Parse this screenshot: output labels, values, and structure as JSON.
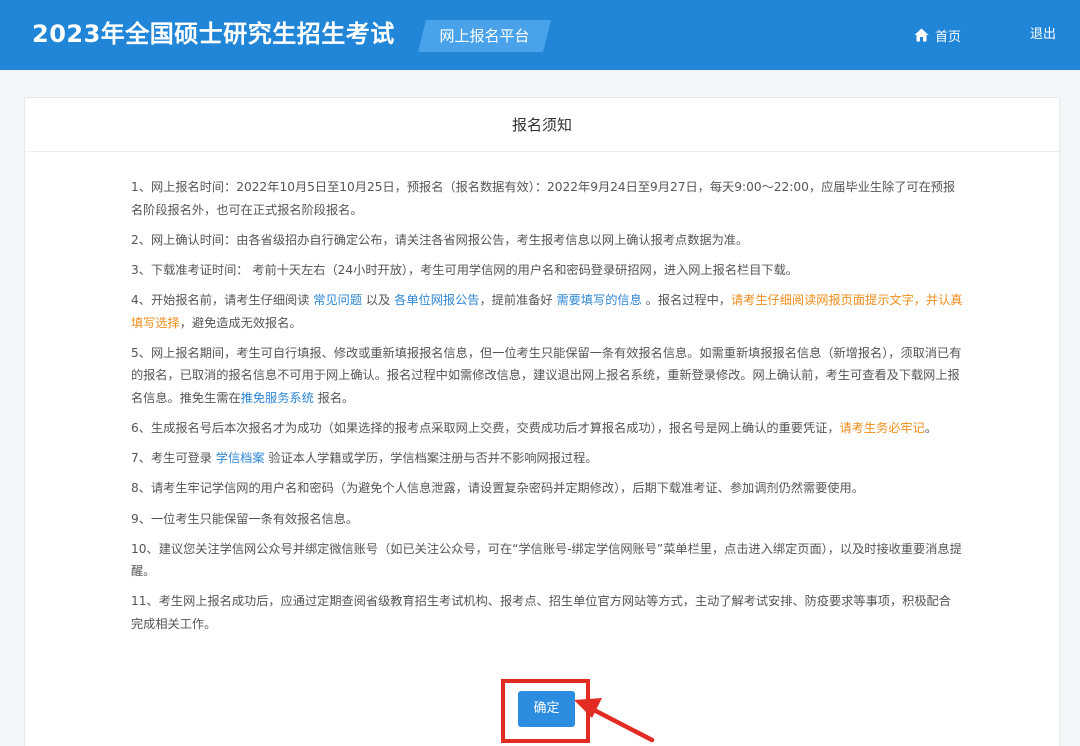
{
  "header": {
    "title": "2023年全国硕士研究生招生考试",
    "platform": "网上报名平台",
    "nav": {
      "home": "首页",
      "logout": "退出"
    }
  },
  "card": {
    "title": "报名须知"
  },
  "notices": {
    "n1": "1、网上报名时间：2022年10月5日至10月25日，预报名（报名数据有效）：2022年9月24日至9月27日，每天9:00～22:00，应届毕业生除了可在预报名阶段报名外，也可在正式报名阶段报名。",
    "n2": "2、网上确认时间：由各省级招办自行确定公布，请关注各省网报公告，考生报考信息以网上确认报考点数据为准。",
    "n3": "3、下载准考证时间： 考前十天左右（24小时开放），考生可用学信网的用户名和密码登录研招网，进入网上报名栏目下载。",
    "n4": {
      "a": "4、开始报名前，请考生仔细阅读 ",
      "link1": "常见问题",
      "b": " 以及 ",
      "link2": "各单位网报公告",
      "c": "，提前准备好 ",
      "link3": "需要填写的信息",
      "d": " 。报名过程中，",
      "hl": "请考生仔细阅读网报页面提示文字，并认真填写选择",
      "e": "，避免造成无效报名。"
    },
    "n5": {
      "a": "5、网上报名期间，考生可自行填报、修改或重新填报报名信息，但一位考生只能保留一条有效报名信息。如需重新填报报名信息（新增报名），须取消已有的报名，已取消的报名信息不可用于网上确认。报名过程中如需修改信息，建议退出网上报名系统，重新登录修改。网上确认前，考生可查看及下载网上报名信息。推免生需在",
      "link": "推免服务系统",
      "b": " 报名。"
    },
    "n6": {
      "a": "6、生成报名号后本次报名才为成功（如果选择的报考点采取网上交费，交费成功后才算报名成功），报名号是网上确认的重要凭证，",
      "hl": "请考生务必牢记",
      "b": "。"
    },
    "n7": {
      "a": "7、考生可登录 ",
      "link": "学信档案",
      "b": " 验证本人学籍或学历，学信档案注册与否并不影响网报过程。"
    },
    "n8": "8、请考生牢记学信网的用户名和密码（为避免个人信息泄露，请设置复杂密码并定期修改），后期下载准考证、参加调剂仍然需要使用。",
    "n9": "9、一位考生只能保留一条有效报名信息。",
    "n10": "10、建议您关注学信网公众号并绑定微信账号（如已关注公众号，可在“学信账号-绑定学信网账号”菜单栏里，点击进入绑定页面），以及时接收重要消息提醒。",
    "n11": "11、考生网上报名成功后，应通过定期查阅省级教育招生考试机构、报考点、招生单位官方网站等方式，主动了解考试安排、防疫要求等事项，积极配合完成相关工作。"
  },
  "confirm_label": "确定",
  "colors": {
    "header_bg": "#2186d8",
    "badge_bg": "#4aa3ea",
    "link": "#2f86d6",
    "highlight": "#f08c1a",
    "button": "#2c8ce0",
    "annotation": "#e22b22"
  },
  "icons": {
    "home": "home-icon",
    "arrow": "red-arrow-icon"
  }
}
